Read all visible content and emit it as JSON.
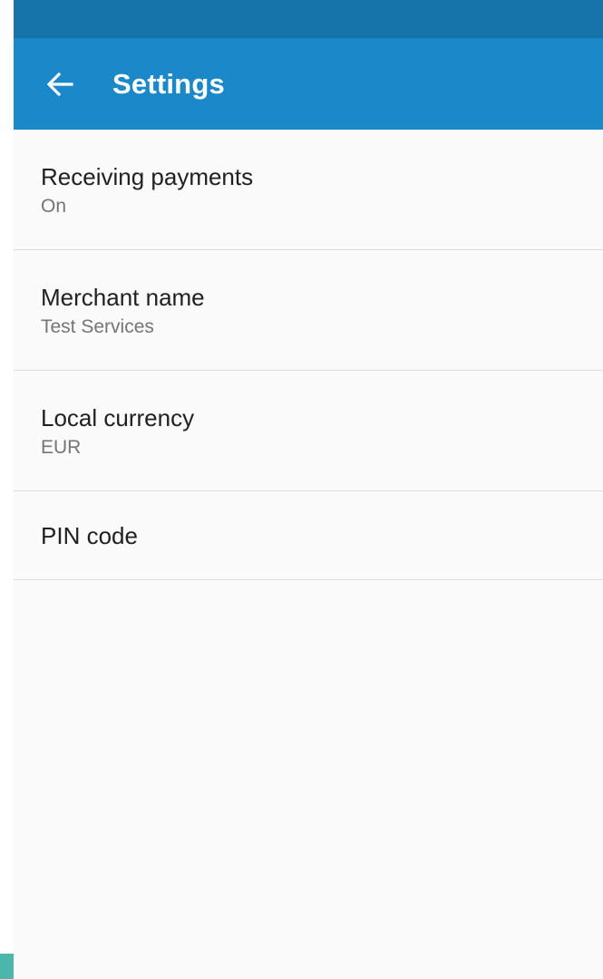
{
  "app_bar": {
    "title": "Settings",
    "back_icon": "arrow-back-icon"
  },
  "settings": [
    {
      "title": "Receiving payments",
      "value": "On"
    },
    {
      "title": "Merchant name",
      "value": "Test Services"
    },
    {
      "title": "Local currency",
      "value": "EUR"
    },
    {
      "title": "PIN code"
    }
  ],
  "colors": {
    "status_bar": "#1774ab",
    "app_bar": "#1b88c9",
    "background": "#fafafa",
    "title_text": "#212121",
    "value_text": "#757575",
    "divider": "#dcdcdc",
    "accent_strip": "#4db6ac"
  }
}
